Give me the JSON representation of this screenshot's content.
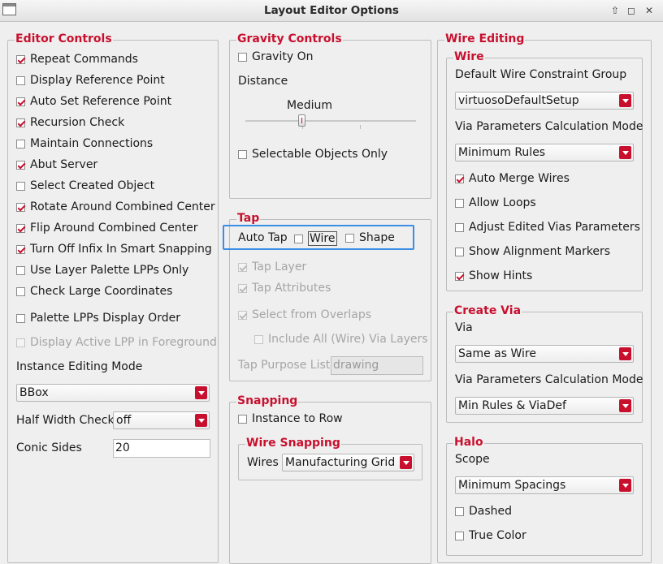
{
  "window": {
    "title": "Layout Editor Options",
    "buttons": {
      "up": "⇧",
      "max": "◻",
      "close": "✕"
    }
  },
  "editor_controls": {
    "title": "Editor Controls",
    "items": [
      {
        "label": "Repeat Commands",
        "checked": true
      },
      {
        "label": "Display Reference Point",
        "checked": false
      },
      {
        "label": "Auto Set Reference Point",
        "checked": true
      },
      {
        "label": "Recursion Check",
        "checked": true
      },
      {
        "label": "Maintain Connections",
        "checked": false
      },
      {
        "label": "Abut Server",
        "checked": true
      },
      {
        "label": "Select Created Object",
        "checked": false
      },
      {
        "label": "Rotate Around Combined Center",
        "checked": true
      },
      {
        "label": "Flip Around Combined Center",
        "checked": true
      },
      {
        "label": "Turn Off Infix In Smart Snapping",
        "checked": true
      },
      {
        "label": "Use Layer Palette LPPs Only",
        "checked": false
      },
      {
        "label": "Check Large Coordinates",
        "checked": false
      },
      {
        "label": "Palette LPPs Display Order",
        "checked": false
      },
      {
        "label": "Display Active LPP in Foreground",
        "checked": false,
        "disabled": true
      }
    ],
    "instance_mode_label": "Instance Editing Mode",
    "instance_mode_value": "BBox",
    "half_width_label": "Half Width Check",
    "half_width_value": "off",
    "conic_label": "Conic Sides",
    "conic_value": "20"
  },
  "gravity": {
    "title": "Gravity Controls",
    "gravity_on": "Gravity On",
    "distance_label": "Distance",
    "distance_value": "Medium",
    "slider_level": 0.33,
    "selectable_only": "Selectable Objects Only"
  },
  "tap": {
    "title": "Tap",
    "auto_tap": "Auto Tap",
    "wire": "Wire",
    "shape": "Shape",
    "tap_layer": "Tap Layer",
    "tap_attributes": "Tap Attributes",
    "select_overlaps": "Select from Overlaps",
    "include_all": "Include All (Wire) Via Layers",
    "purpose_label": "Tap Purpose List",
    "purpose_value": "drawing"
  },
  "snapping": {
    "title": "Snapping",
    "instance_to_row": "Instance to Row",
    "wire_snapping_title": "Wire Snapping",
    "wires_label": "Wires",
    "wires_value": "Manufacturing Grid"
  },
  "wire_editing": {
    "title": "Wire Editing",
    "wire": {
      "title": "Wire",
      "constraint_label": "Default Wire Constraint Group",
      "constraint_value": "virtuosoDefaultSetup",
      "via_calc_label": "Via Parameters Calculation Mode",
      "via_calc_value": "Minimum Rules",
      "auto_merge": "Auto Merge Wires",
      "allow_loops": "Allow Loops",
      "adjust_vias": "Adjust Edited Vias Parameters",
      "show_alignment": "Show Alignment Markers",
      "show_hints": "Show Hints"
    },
    "create_via": {
      "title": "Create Via",
      "via_label": "Via",
      "via_value": "Same as Wire",
      "via_calc_label": "Via Parameters Calculation Mode",
      "via_calc_value": "Min Rules & ViaDef"
    },
    "halo": {
      "title": "Halo",
      "scope_label": "Scope",
      "scope_value": "Minimum Spacings",
      "dashed": "Dashed",
      "true_color": "True Color"
    }
  }
}
